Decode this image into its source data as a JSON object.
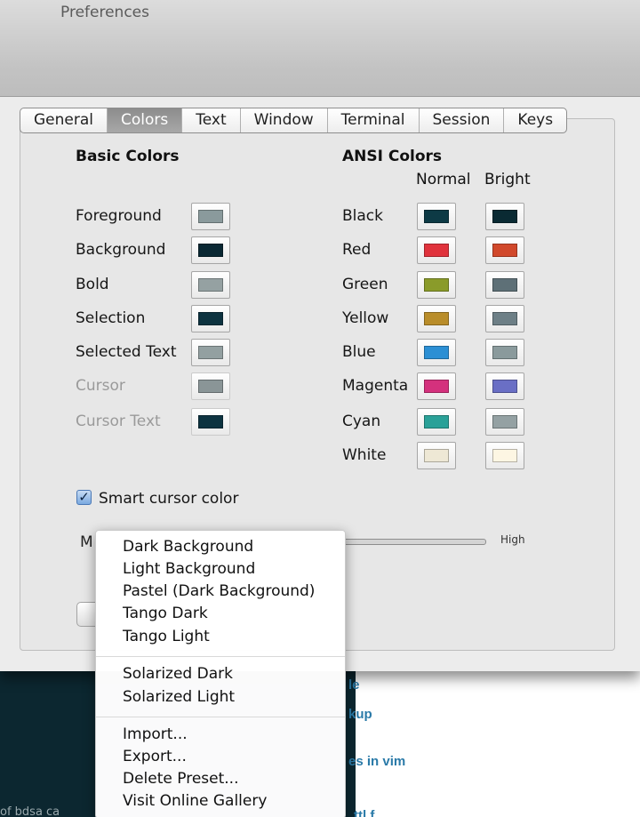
{
  "window": {
    "title": "Preferences"
  },
  "tabs": [
    {
      "label": "General",
      "active": false
    },
    {
      "label": "Colors",
      "active": true
    },
    {
      "label": "Text",
      "active": false
    },
    {
      "label": "Window",
      "active": false
    },
    {
      "label": "Terminal",
      "active": false
    },
    {
      "label": "Session",
      "active": false
    },
    {
      "label": "Keys",
      "active": false
    }
  ],
  "basic": {
    "title": "Basic Colors",
    "items": [
      {
        "label": "Foreground",
        "color": "#8a9a9c",
        "enabled": true
      },
      {
        "label": "Background",
        "color": "#0a2833",
        "enabled": true
      },
      {
        "label": "Bold",
        "color": "#95a1a2",
        "enabled": true
      },
      {
        "label": "Selection",
        "color": "#0d3340",
        "enabled": true
      },
      {
        "label": "Selected Text",
        "color": "#93a0a1",
        "enabled": true
      },
      {
        "label": "Cursor",
        "color": "#8a9597",
        "enabled": false
      },
      {
        "label": "Cursor Text",
        "color": "#0d3340",
        "enabled": false
      }
    ]
  },
  "ansi": {
    "title": "ANSI Colors",
    "normal_label": "Normal",
    "bright_label": "Bright",
    "items": [
      {
        "label": "Black",
        "normal": "#0d3a45",
        "bright": "#0a2a33"
      },
      {
        "label": "Red",
        "normal": "#e0323c",
        "bright": "#d1482b"
      },
      {
        "label": "Green",
        "normal": "#8a9b2a",
        "bright": "#5e7077"
      },
      {
        "label": "Yellow",
        "normal": "#b98d2a",
        "bright": "#6d7f86"
      },
      {
        "label": "Blue",
        "normal": "#2b8fd4",
        "bright": "#8a9a9c"
      },
      {
        "label": "Magenta",
        "normal": "#d4317d",
        "bright": "#6a6fc5"
      },
      {
        "label": "Cyan",
        "normal": "#2aa198",
        "bright": "#94a1a3"
      },
      {
        "label": "White",
        "normal": "#eee8d5",
        "bright": "#fdf6e3"
      }
    ]
  },
  "smart_cursor": {
    "label": "Smart cursor color",
    "checked": true
  },
  "slider": {
    "start_label": "M",
    "end_label": "High"
  },
  "menu": {
    "groups": [
      [
        "Dark Background",
        "Light Background",
        "Pastel (Dark Background)",
        "Tango Dark",
        "Tango Light"
      ],
      [
        "Solarized Dark",
        "Solarized Light"
      ],
      [
        "Import...",
        "Export...",
        "Delete Preset...",
        "Visit Online Gallery"
      ]
    ]
  },
  "background_window": {
    "lines": [
      "le",
      "kup",
      "es in vim",
      "ttl f"
    ],
    "dark_text": "of bdsa ca"
  }
}
